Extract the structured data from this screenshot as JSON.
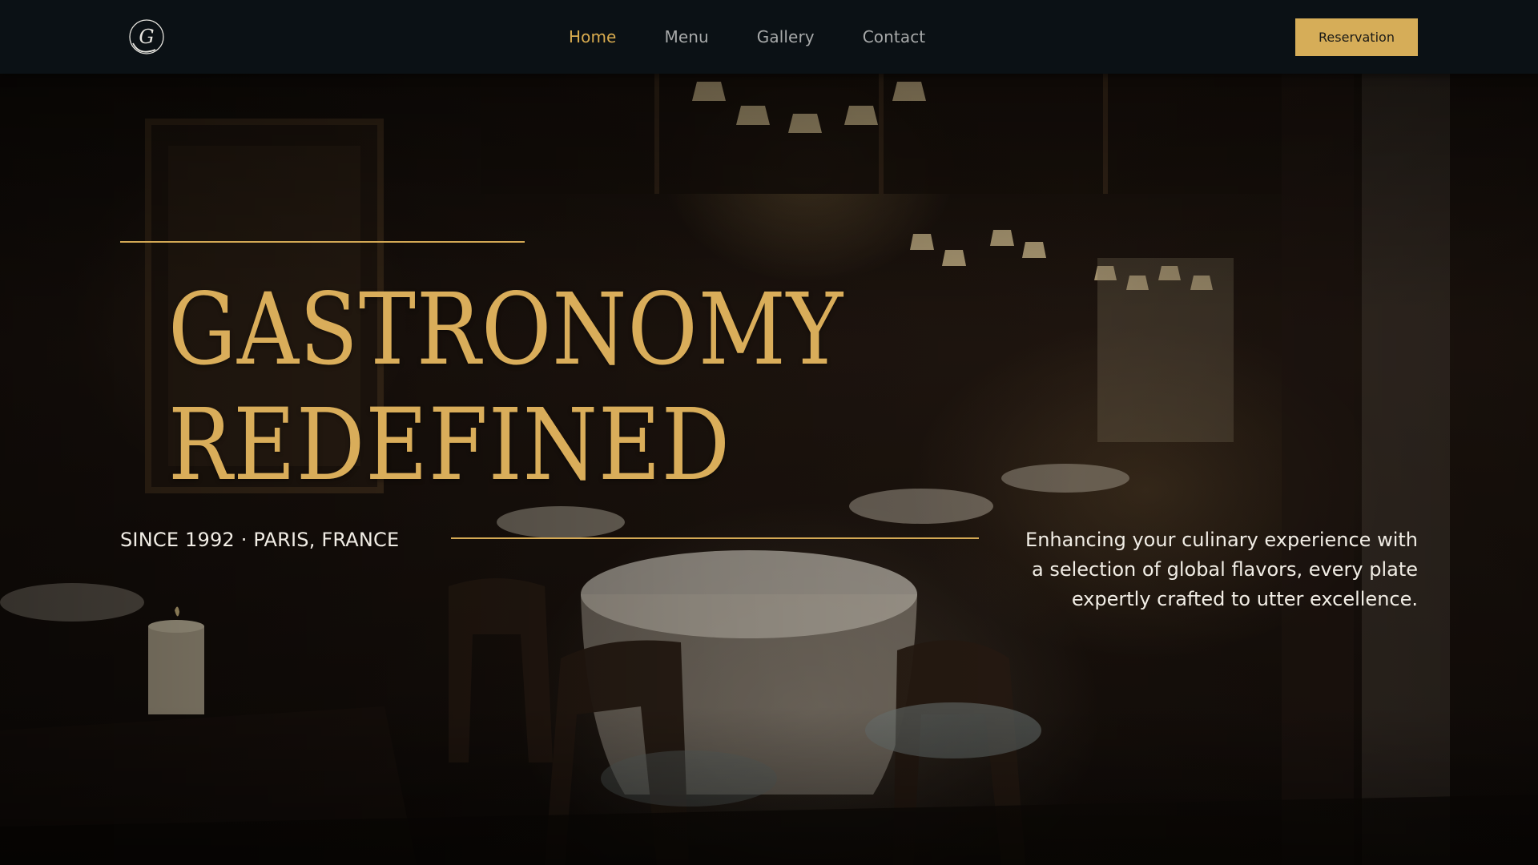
{
  "header": {
    "logo_text": "G",
    "nav": [
      {
        "label": "Home",
        "active": true
      },
      {
        "label": "Menu",
        "active": false
      },
      {
        "label": "Gallery",
        "active": false
      },
      {
        "label": "Contact",
        "active": false
      }
    ],
    "reservation_label": "Reservation"
  },
  "hero": {
    "headline_line1": "GASTRONOMY",
    "headline_line2": "REDEFINED",
    "since": "SINCE 1992 · PARIS, FRANCE",
    "tagline": "Enhancing your culinary experience with a selection of global flavors, every plate expertly crafted to utter excellence.",
    "background": "restaurant-interior-image"
  },
  "colors": {
    "accent_gold": "#d6ad58",
    "header_bg": "#0b1115",
    "nav_text": "#a7a9a9",
    "body_text": "#f1ede5"
  }
}
